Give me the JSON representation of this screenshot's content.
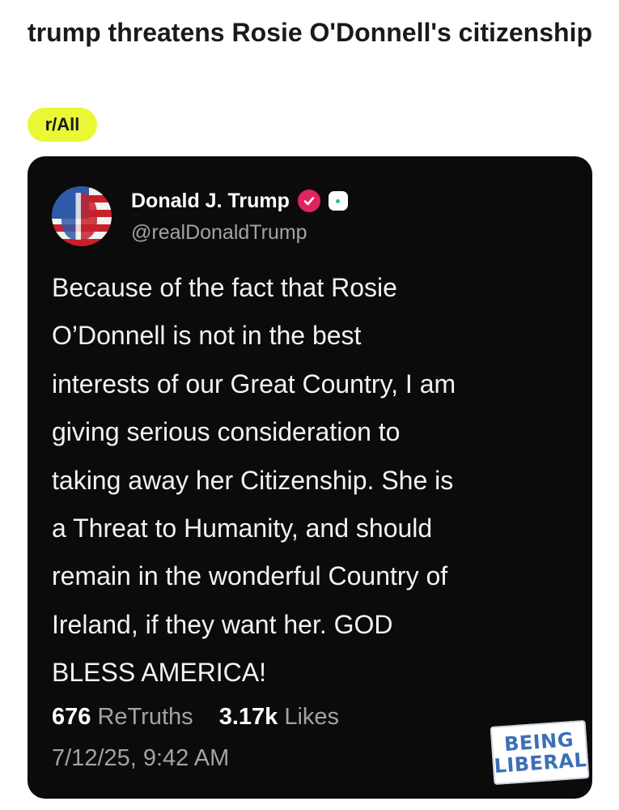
{
  "post": {
    "title": "trump threatens Rosie O'Donnell's citizenship",
    "subreddit": "r/All"
  },
  "card": {
    "author": {
      "display_name": "Donald J. Trump",
      "handle": "@realDonaldTrump",
      "verified_badge_color": "#e0245e"
    },
    "body": "Because of the fact that Rosie\nO’Donnell is not in the best\ninterests of our Great Country, I am\ngiving serious consideration to\ntaking away her Citizenship. She is\na Threat to Humanity, and should\nremain in the wonderful Country of\nIreland, if they want her. GOD\nBLESS AMERICA!",
    "stats": {
      "retruths_count": "676",
      "retruths_label": "ReTruths",
      "likes_count": "3.17k",
      "likes_label": "Likes"
    },
    "timestamp": "7/12/25, 9:42 AM",
    "watermark": {
      "line1": "BEING",
      "line2": "LIBERAL"
    }
  },
  "colors": {
    "chip_background": "#eaf734",
    "card_background": "#0b0b0b",
    "muted_text": "#a3a3a3"
  }
}
